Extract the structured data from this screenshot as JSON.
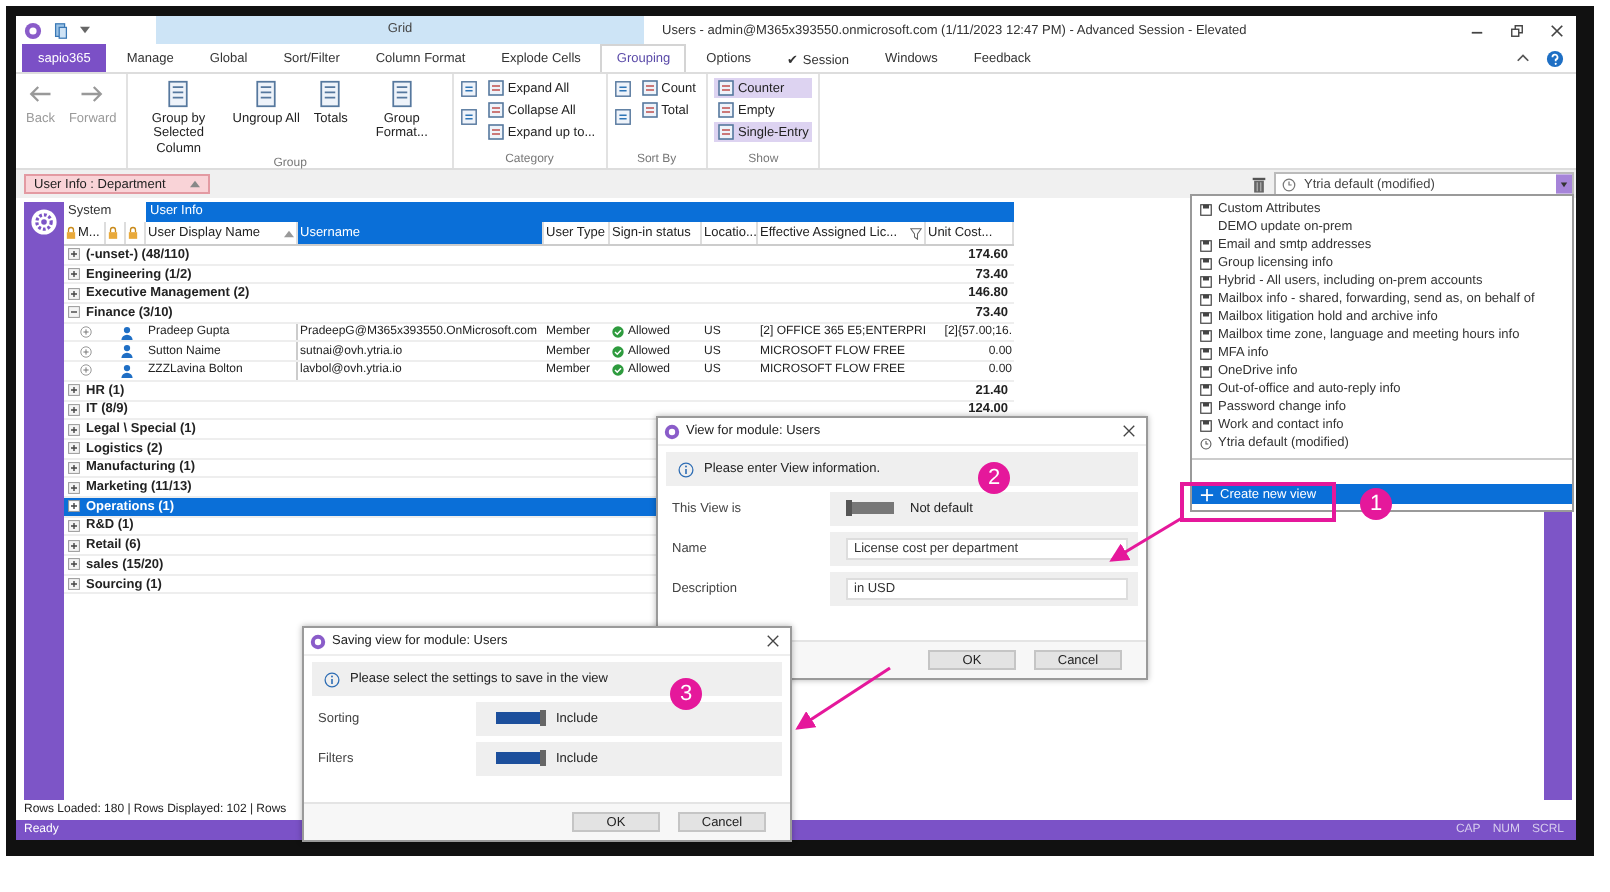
{
  "title_bar": {
    "context_tab": "Grid",
    "title": "Users - admin@M365x393550.onmicrosoft.com (1/11/2023 12:47 PM) - Advanced Session - Elevated"
  },
  "menu_tabs": [
    {
      "label": "sapio365",
      "kind": "brand",
      "selected": false
    },
    {
      "label": "Manage",
      "kind": "tab",
      "selected": false
    },
    {
      "label": "Global",
      "kind": "tab",
      "selected": false
    },
    {
      "label": "Sort/Filter",
      "kind": "tab",
      "selected": false
    },
    {
      "label": "Column Format",
      "kind": "tab",
      "selected": false
    },
    {
      "label": "Explode Cells",
      "kind": "tab",
      "selected": false
    },
    {
      "label": "Grouping",
      "kind": "tab",
      "selected": true
    },
    {
      "label": "Options",
      "kind": "tab",
      "selected": false
    },
    {
      "label": "✔ Session",
      "kind": "tab",
      "selected": false
    },
    {
      "label": "Windows",
      "kind": "tab",
      "selected": false
    },
    {
      "label": "Feedback",
      "kind": "tab",
      "selected": false
    }
  ],
  "ribbon": {
    "groups": [
      {
        "columns": [
          [
            {
              "label": "Back",
              "kind": "large",
              "disabled": true
            }
          ],
          [
            {
              "label": "Forward",
              "kind": "large",
              "disabled": true
            }
          ]
        ]
      },
      {
        "label": "Group",
        "columns": [
          [
            {
              "label": "Group by Selected Column",
              "kind": "large",
              "disabled": false
            }
          ],
          [
            {
              "label": "Ungroup All",
              "kind": "large",
              "disabled": false
            }
          ],
          [
            {
              "label": "Totals",
              "kind": "large",
              "disabled": false
            }
          ],
          [
            {
              "label": "Group Format...",
              "kind": "large",
              "disabled": false
            }
          ]
        ]
      },
      {
        "label": "Category",
        "columns": [
          [
            {
              "kind": "icon"
            },
            {
              "kind": "icon"
            }
          ],
          [
            {
              "label": "Expand All",
              "kind": "small",
              "selected": false
            },
            {
              "label": "Collapse All",
              "kind": "small",
              "selected": false
            },
            {
              "label": "Expand up to...",
              "kind": "small",
              "selected": false
            }
          ]
        ]
      },
      {
        "label": "Sort By",
        "columns": [
          [
            {
              "kind": "icon"
            },
            {
              "kind": "icon"
            }
          ],
          [
            {
              "label": "Count",
              "kind": "small",
              "selected": false
            },
            {
              "label": "Total",
              "kind": "small",
              "selected": false
            }
          ]
        ]
      },
      {
        "label": "Show",
        "columns": [
          [
            {
              "label": "Counter",
              "kind": "small",
              "selected": true
            },
            {
              "label": "Empty",
              "kind": "small",
              "selected": false
            },
            {
              "label": "Single-Entry",
              "kind": "small",
              "selected": true
            }
          ]
        ]
      }
    ]
  },
  "group_by": {
    "chip": "User Info : Department",
    "view": "Ytria default (modified)"
  },
  "grid": {
    "header_groups": [
      {
        "label": "System",
        "selected": false
      },
      {
        "label": "User Info",
        "selected": true
      }
    ],
    "columns": [
      {
        "kind": "lock-text",
        "label": "M...",
        "selected": false,
        "sorted": false,
        "filtered": false
      },
      {
        "kind": "lock",
        "selected": false,
        "sorted": false,
        "filtered": false
      },
      {
        "kind": "lock",
        "selected": false,
        "sorted": false,
        "filtered": false
      },
      {
        "kind": "text",
        "label": "User Display Name",
        "selected": false,
        "sorted": true,
        "filtered": false
      },
      {
        "kind": "text",
        "label": "Username",
        "selected": true,
        "sorted": false,
        "filtered": false
      },
      {
        "kind": "text",
        "label": "User Type",
        "selected": false,
        "sorted": false,
        "filtered": false
      },
      {
        "kind": "text",
        "label": "Sign-in status",
        "selected": false,
        "sorted": false,
        "filtered": false
      },
      {
        "kind": "text",
        "label": "Locatio...",
        "selected": false,
        "sorted": false,
        "filtered": false
      },
      {
        "kind": "text",
        "label": "Effective Assigned Lic...",
        "selected": false,
        "sorted": false,
        "filtered": true
      },
      {
        "kind": "text",
        "label": "Unit Cost...",
        "selected": false,
        "sorted": false,
        "filtered": false
      }
    ],
    "groups": [
      {
        "label": "(-unset-) (48/110)",
        "total": "174.60",
        "expanded": false,
        "selected": false
      },
      {
        "label": "Engineering (1/2)",
        "total": "73.40",
        "expanded": false,
        "selected": false
      },
      {
        "label": "Executive Management (2)",
        "total": "146.80",
        "expanded": false,
        "selected": false
      },
      {
        "label": "Finance (3/10)",
        "total": "73.40",
        "expanded": true,
        "selected": false,
        "children": [
          {
            "display_name": "Pradeep Gupta",
            "username": "PradeepG@M365x393550.OnMicrosoft.com",
            "user_type": "Member",
            "sign_in": "Allowed",
            "location": "US",
            "license": "[2] OFFICE 365 E5;ENTERPRI",
            "unit_cost": "[2]{57.00;16."
          },
          {
            "display_name": "Sutton Naime",
            "username": "sutnai@ovh.ytria.io",
            "user_type": "Member",
            "sign_in": "Allowed",
            "location": "US",
            "license": "MICROSOFT FLOW FREE",
            "unit_cost": "0.00"
          },
          {
            "display_name": "ZZZLavina Bolton",
            "username": "lavbol@ovh.ytria.io",
            "user_type": "Member",
            "sign_in": "Allowed",
            "location": "US",
            "license": "MICROSOFT FLOW FREE",
            "unit_cost": "0.00"
          }
        ]
      },
      {
        "label": "HR (1)",
        "total": "21.40",
        "expanded": false,
        "selected": false
      },
      {
        "label": "IT (8/9)",
        "total": "124.00",
        "expanded": false,
        "selected": false
      },
      {
        "label": "Legal \\ Special (1)",
        "expanded": false,
        "selected": false
      },
      {
        "label": "Logistics (2)",
        "expanded": false,
        "selected": false
      },
      {
        "label": "Manufacturing (1)",
        "expanded": false,
        "selected": false
      },
      {
        "label": "Marketing (11/13)",
        "expanded": false,
        "selected": false
      },
      {
        "label": "Operations (1)",
        "expanded": false,
        "selected": true
      },
      {
        "label": "R&D (1)",
        "expanded": false,
        "selected": false
      },
      {
        "label": "Retail (6)",
        "expanded": false,
        "selected": false
      },
      {
        "label": "sales (15/20)",
        "expanded": false,
        "selected": false
      },
      {
        "label": "Sourcing (1)",
        "expanded": false,
        "selected": false
      }
    ]
  },
  "dropdown": {
    "items": [
      {
        "label": "Custom Attributes",
        "kind": "saved"
      },
      {
        "label": "DEMO update on-prem",
        "kind": "plain"
      },
      {
        "label": "Email and smtp addresses",
        "kind": "saved"
      },
      {
        "label": "Group licensing info",
        "kind": "saved"
      },
      {
        "label": "Hybrid - All users, including on-prem accounts",
        "kind": "saved"
      },
      {
        "label": "Mailbox info - shared, forwarding, send as, on behalf of",
        "kind": "saved"
      },
      {
        "label": "Mailbox litigation hold and archive info",
        "kind": "saved"
      },
      {
        "label": "Mailbox time zone, language and meeting hours info",
        "kind": "saved"
      },
      {
        "label": "MFA info",
        "kind": "saved"
      },
      {
        "label": "OneDrive info",
        "kind": "saved"
      },
      {
        "label": "Out-of-office and auto-reply info",
        "kind": "saved"
      },
      {
        "label": "Password change info",
        "kind": "saved"
      },
      {
        "label": "Work and contact info",
        "kind": "saved"
      },
      {
        "label": "Ytria default (modified)",
        "kind": "current"
      }
    ],
    "actions": [
      {
        "label": "Create new view",
        "selected": true
      }
    ]
  },
  "dialogs": [
    {
      "title": "View for module: Users",
      "info": "Please enter View information.",
      "fields": [
        {
          "label": "This View is",
          "kind": "toggle",
          "on": false,
          "text": "Not default"
        },
        {
          "label": "Name",
          "kind": "input",
          "value": "License cost per department"
        },
        {
          "label": "Description",
          "kind": "input",
          "value": "in USD"
        }
      ],
      "buttons": [
        "OK",
        "Cancel"
      ]
    },
    {
      "title": "Saving view for module: Users",
      "info": "Please select the settings to save in the view",
      "fields": [
        {
          "label": "Sorting",
          "kind": "toggle",
          "on": true,
          "text": "Include"
        },
        {
          "label": "Filters",
          "kind": "toggle",
          "on": true,
          "text": "Include"
        }
      ],
      "buttons": [
        "OK",
        "Cancel"
      ]
    }
  ],
  "callouts": [
    {
      "number": "1"
    },
    {
      "number": "2"
    },
    {
      "number": "3"
    }
  ],
  "status_bar": {
    "rows_info": "Rows Loaded: 180 | Rows Displayed: 102 | Rows",
    "state": "Ready",
    "indicators": [
      "CAP",
      "NUM",
      "SCRL"
    ]
  }
}
